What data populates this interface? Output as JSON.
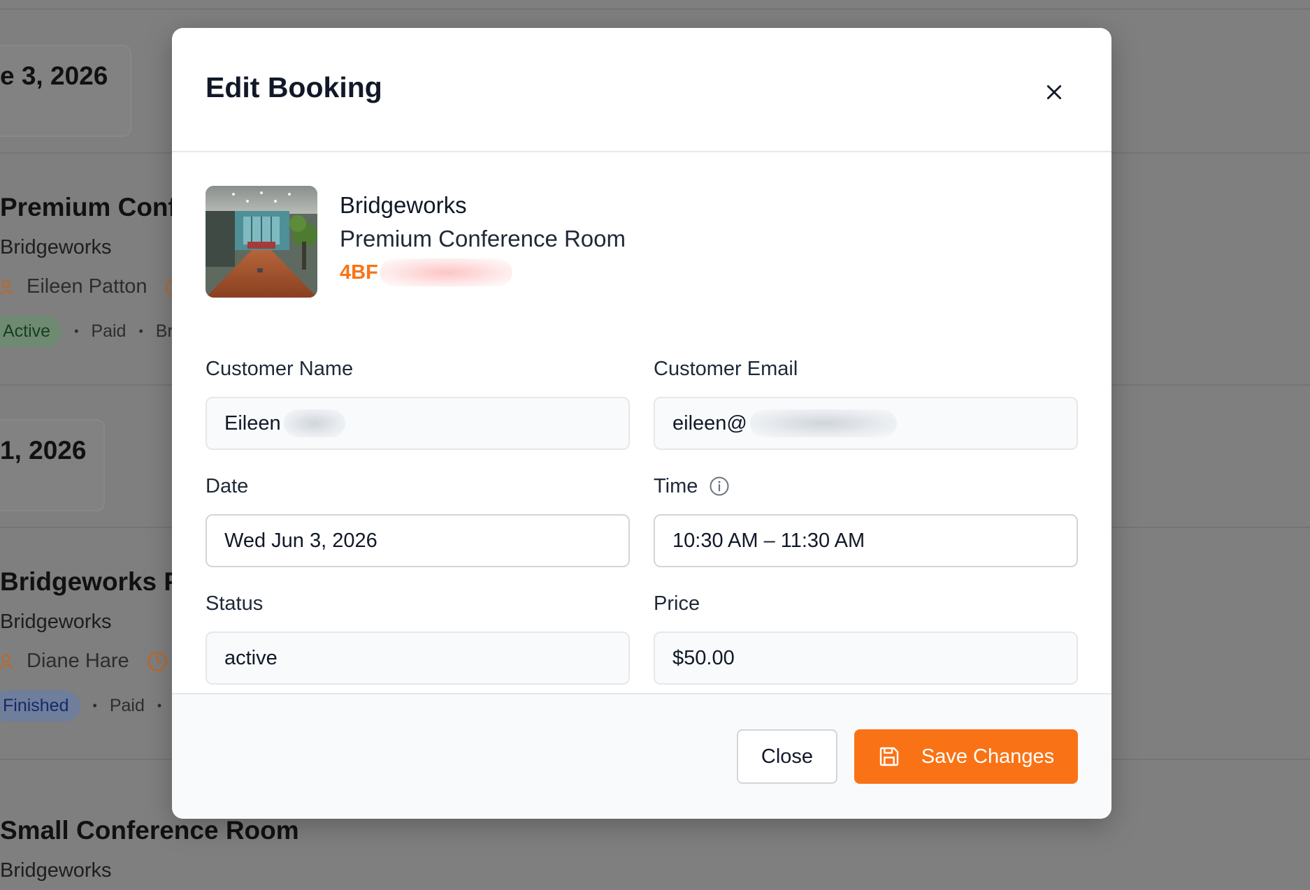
{
  "background": {
    "date_cards": [
      "e 3, 2026",
      "1, 2026"
    ],
    "bookings": [
      {
        "title": "Premium Confe",
        "venue": "Bridgeworks",
        "person": "Eileen Patton",
        "badge": "Active",
        "payment": "Paid",
        "extra": "Bri"
      },
      {
        "title": "Bridgeworks P",
        "venue": "Bridgeworks",
        "person": "Diane Hare",
        "badge": "Finished",
        "payment": "Paid",
        "extra": ""
      },
      {
        "title": "Small Conference Room",
        "venue": "Bridgeworks"
      }
    ]
  },
  "modal": {
    "title": "Edit Booking",
    "room": {
      "venue": "Bridgeworks",
      "name": "Premium Conference Room",
      "code_visible": "4BF"
    },
    "fields": {
      "customer_name": {
        "label": "Customer Name",
        "value": "Eileen"
      },
      "customer_email": {
        "label": "Customer Email",
        "value": "eileen@"
      },
      "date": {
        "label": "Date",
        "value": "Wed Jun 3, 2026"
      },
      "time": {
        "label": "Time",
        "value": "10:30 AM – 11:30 AM"
      },
      "status": {
        "label": "Status",
        "value": "active"
      },
      "price": {
        "label": "Price",
        "value": "$50.00"
      }
    },
    "footer": {
      "close_label": "Close",
      "save_label": "Save Changes"
    }
  },
  "colors": {
    "accent": "#f97316",
    "overlay": "#7f7f7f",
    "modal_bg": "#ffffff"
  },
  "icons": {
    "close": "x-icon",
    "time_info": "info-icon",
    "save": "floppy-disk-icon",
    "person": "user-icon",
    "clock": "clock-icon"
  }
}
